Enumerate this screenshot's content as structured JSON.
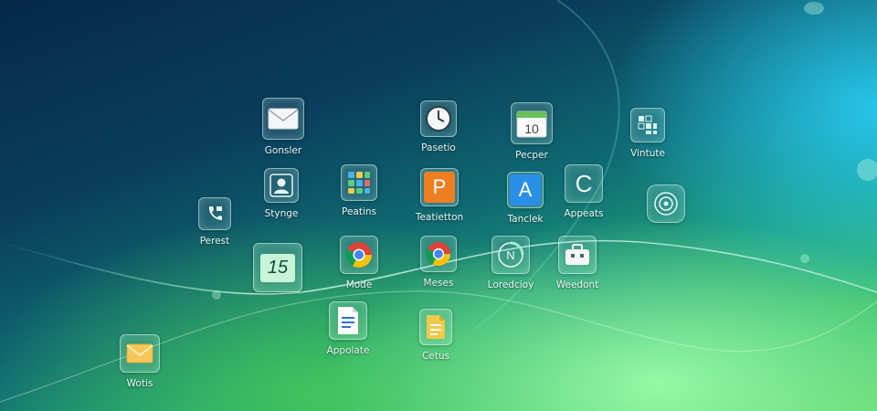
{
  "desktop": {
    "icons": [
      {
        "label": "Gonsler",
        "icon": "mail-icon"
      },
      {
        "label": "Pasetio",
        "icon": "clock-icon"
      },
      {
        "label": "Pecper",
        "icon": "calendar-icon",
        "value": "10"
      },
      {
        "label": "Vintute",
        "icon": "grid-app-icon"
      },
      {
        "label": "Perest",
        "icon": "phone-icon"
      },
      {
        "label": "Stynge",
        "icon": "contacts-icon"
      },
      {
        "label": "Peatins",
        "icon": "apps-grid-icon"
      },
      {
        "label": "Teatietton",
        "icon": "p-letter-icon",
        "value": "P"
      },
      {
        "label": "Tanclek",
        "icon": "a-letter-icon",
        "value": "A"
      },
      {
        "label": "Appeats",
        "icon": "refresh-icon",
        "value": "C"
      },
      {
        "label": "",
        "icon": "settings-circle-icon"
      },
      {
        "label": "",
        "icon": "calendar-folder-icon",
        "value": "15"
      },
      {
        "label": "Mode",
        "icon": "chrome-icon"
      },
      {
        "label": "Meses",
        "icon": "chrome-icon"
      },
      {
        "label": "Loredcioy",
        "icon": "chart-circle-icon",
        "value": "N"
      },
      {
        "label": "Weedont",
        "icon": "toolbox-icon"
      },
      {
        "label": "Appolate",
        "icon": "docs-icon"
      },
      {
        "label": "Cetus",
        "icon": "notes-icon"
      },
      {
        "label": "Wotis",
        "icon": "envelope-yellow-icon"
      }
    ]
  },
  "colors": {
    "accent_orange": "#ef7d22",
    "accent_blue": "#2a8fe6",
    "docs_blue": "#2f6fd8",
    "notes_yellow": "#f2c94c",
    "label_text": "#eaf6f4"
  }
}
